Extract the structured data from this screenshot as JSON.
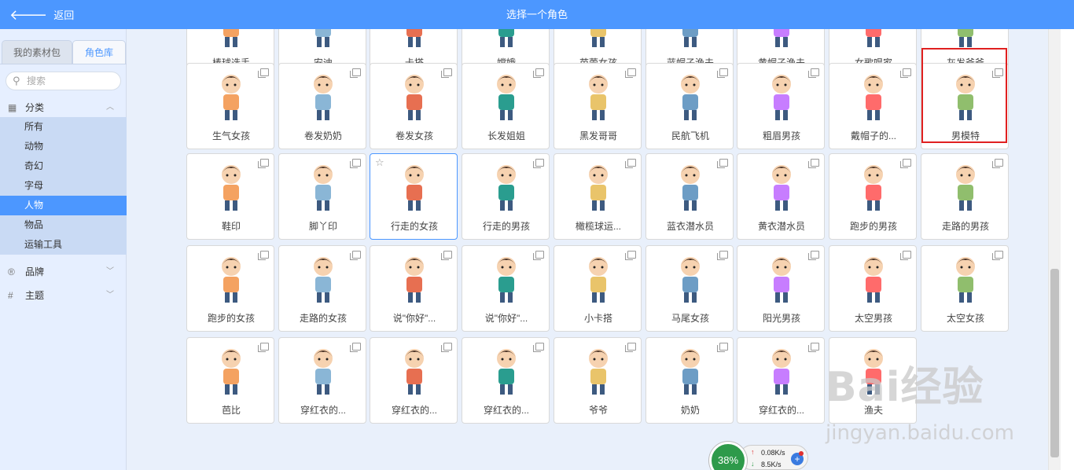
{
  "header": {
    "back_label": "返回",
    "title": "选择一个角色"
  },
  "sidebar": {
    "tabs": [
      "我的素材包",
      "角色库"
    ],
    "search_placeholder": "搜索",
    "categories": [
      {
        "icon": "grid-icon",
        "label": "分类"
      },
      {
        "icon": "brand-icon",
        "label": "品牌"
      },
      {
        "icon": "hashtag-icon",
        "label": "主题"
      }
    ],
    "subcategories": [
      "所有",
      "动物",
      "奇幻",
      "字母",
      "人物",
      "物品",
      "运输工具"
    ],
    "active_subcategory": "人物"
  },
  "grid": {
    "rows": [
      [
        "棒球选手",
        "安迪",
        "卡搭",
        "嫦娥",
        "芭蕾女孩",
        "蓝帽子渔夫",
        "黄帽子渔夫",
        "女歌唱家",
        "灰发爷爷"
      ],
      [
        "生气女孩",
        "卷发奶奶",
        "卷发女孩",
        "长发姐姐",
        "黑发哥哥",
        "民航飞机",
        "粗眉男孩",
        "戴帽子的...",
        "男模特"
      ],
      [
        "鞋印",
        "脚丫印",
        "行走的女孩",
        "行走的男孩",
        "橄榄球运...",
        "蓝衣潜水员",
        "黄衣潜水员",
        "跑步的男孩",
        "走路的男孩"
      ],
      [
        "跑步的女孩",
        "走路的女孩",
        "说\"你好\"...",
        "说\"你好\"...",
        "小卡搭",
        "马尾女孩",
        "阳光男孩",
        "太空男孩",
        "太空女孩"
      ],
      [
        "芭比",
        "穿红衣的...",
        "穿红衣的...",
        "穿红衣的...",
        "爷爷",
        "奶奶",
        "穿红衣的...",
        "渔夫"
      ]
    ]
  },
  "widget": {
    "percent": "38%",
    "upload": "0.08K/s",
    "download": "8.5K/s"
  },
  "watermark": {
    "brand": "Bai经验",
    "url": "jingyan.baidu.com"
  },
  "colors": {
    "accent": "#4c97ff",
    "highlight": "#e02020"
  }
}
